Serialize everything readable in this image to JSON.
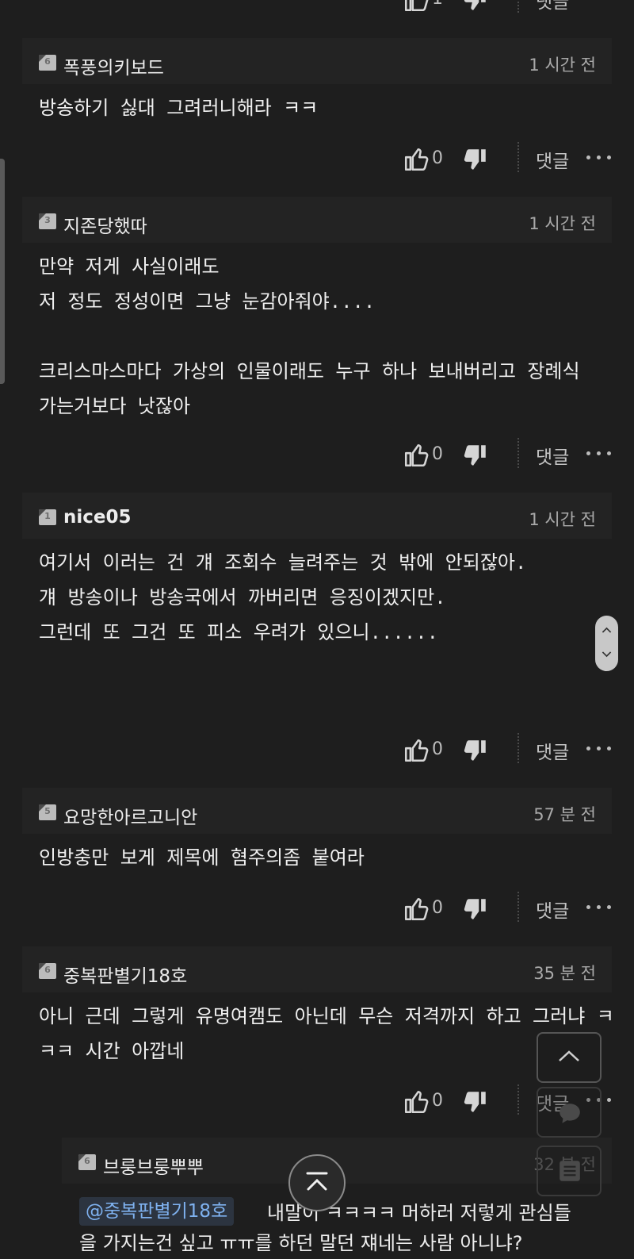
{
  "colors": {
    "background": "#1e1e1e",
    "header_bg": "#232323",
    "mention": "#7fb2f0"
  },
  "action_labels": {
    "reply": "댓글"
  },
  "comments": [
    {
      "level": "6",
      "author": "폭풍의키보드",
      "time": "1 시간 전",
      "body": "방송하기 싫대 그려러니해라 ㅋㅋ",
      "likes": "0"
    },
    {
      "level": "3",
      "author": "지존당했따",
      "time": "1 시간 전",
      "body": "만약 저게 사실이래도\n저 정도 정성이면 그냥 눈감아줘야....\n\n크리스마스마다 가상의 인물이래도 누구 하나 보내버리고 장례식\n가는거보다 낫잖아",
      "likes": "0"
    },
    {
      "level": "1",
      "author": "nice05",
      "time": "1 시간 전",
      "body": "여기서 이러는 건 걔 조회수 늘려주는 것 밖에 안되잖아.\n걔 방송이나 방송국에서 까버리면 응징이겠지만.\n그런데 또 그건 또 피소 우려가 있으니......",
      "likes": "0"
    },
    {
      "level": "5",
      "author": "요망한아르고니안",
      "time": "57 분 전",
      "body": "인방충만 보게 제목에 혐주의좀 붙여라",
      "likes": "0"
    },
    {
      "level": "6",
      "author": "중복판별기18호",
      "time": "35 분 전",
      "body": "아니 근데 그렇게 유명여캠도 아닌데 무슨 저격까지 하고 그러냐 ㅋ\nㅋㅋ 시간 아깝네",
      "likes": "0"
    }
  ],
  "reply": {
    "level": "6",
    "author": "브룽브룽뿌뿌",
    "time": "32 분 전",
    "mention": "@중복판별기18호",
    "line1": "내말이 ㅋㅋㅋㅋ 머하러 저렇게 관심들",
    "line2": "을 가지는건 싶고 ㅠㅠ를 하던 말던 쟤네는 사람 아니냐?"
  },
  "icons": [
    "thumbs-up-icon",
    "thumbs-down-icon",
    "more-dots-icon",
    "chevron-up-icon",
    "comment-bubble-icon",
    "list-icon",
    "scroll-top-icon"
  ]
}
